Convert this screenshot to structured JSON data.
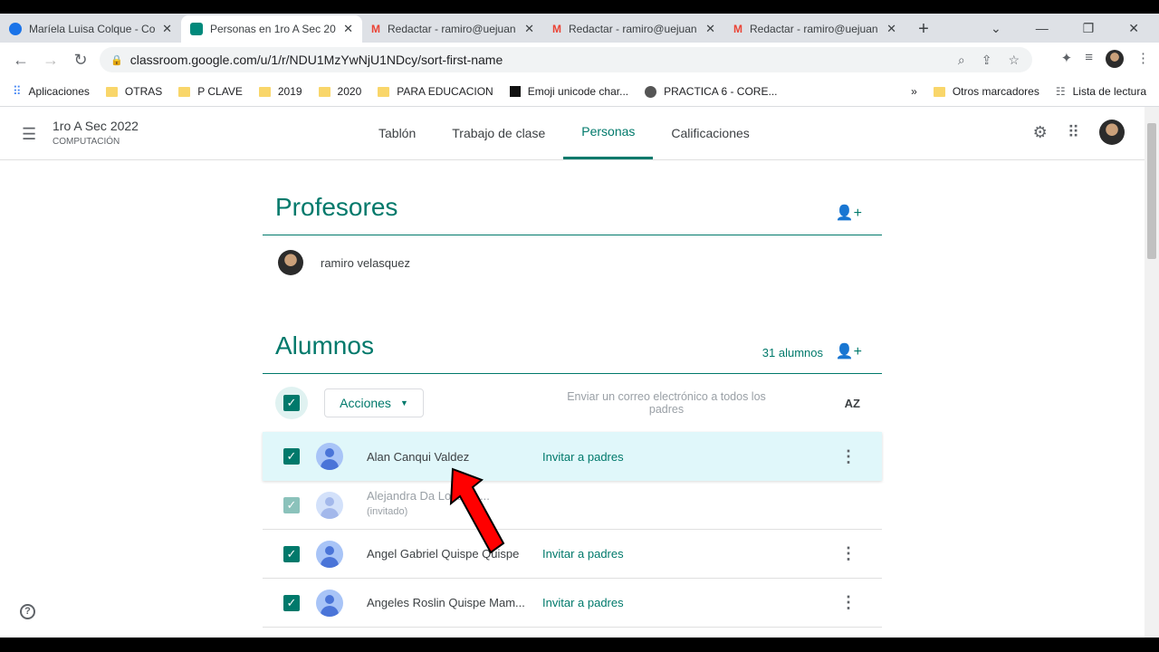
{
  "browser": {
    "tabs": [
      {
        "title": "Maríela Luisa Colque - Co",
        "color": "#1a73e8"
      },
      {
        "title": "Personas en 1ro A Sec 20",
        "color": "#00897b",
        "active": true
      },
      {
        "title": "Redactar - ramiro@uejuan",
        "color": "#ea4335"
      },
      {
        "title": "Redactar - ramiro@uejuan",
        "color": "#ea4335"
      },
      {
        "title": "Redactar - ramiro@uejuan",
        "color": "#ea4335"
      }
    ],
    "url": "classroom.google.com/u/1/r/NDU1MzYwNjU1NDcy/sort-first-name",
    "bookmarks": [
      "Aplicaciones",
      "OTRAS",
      "P CLAVE",
      "2019",
      "2020",
      "PARA EDUCACION",
      "Emoji unicode char...",
      "PRACTICA 6 - CORE..."
    ],
    "other_bookmarks": "Otros marcadores",
    "reading_list": "Lista de lectura"
  },
  "header": {
    "class_name": "1ro A Sec 2022",
    "subject": "COMPUTACIÓN",
    "tabs": [
      "Tablón",
      "Trabajo de clase",
      "Personas",
      "Calificaciones"
    ]
  },
  "teachers": {
    "title": "Profesores",
    "list": [
      "ramiro velasquez"
    ]
  },
  "students": {
    "title": "Alumnos",
    "count": "31 alumnos",
    "actions": "Acciones",
    "email_parents": "Enviar un correo electrónico a todos los padres",
    "sort": "AZ",
    "list": [
      {
        "name": "Alan Canqui Valdez",
        "invite": "Invitar a padres"
      },
      {
        "name": "Alejandra Da Lozano ...",
        "status": "(invitado)"
      },
      {
        "name": "Angel Gabriel Quispe Quispe",
        "invite": "Invitar a padres"
      },
      {
        "name": "Angeles Roslin Quispe Mam...",
        "invite": "Invitar a padres"
      }
    ]
  }
}
